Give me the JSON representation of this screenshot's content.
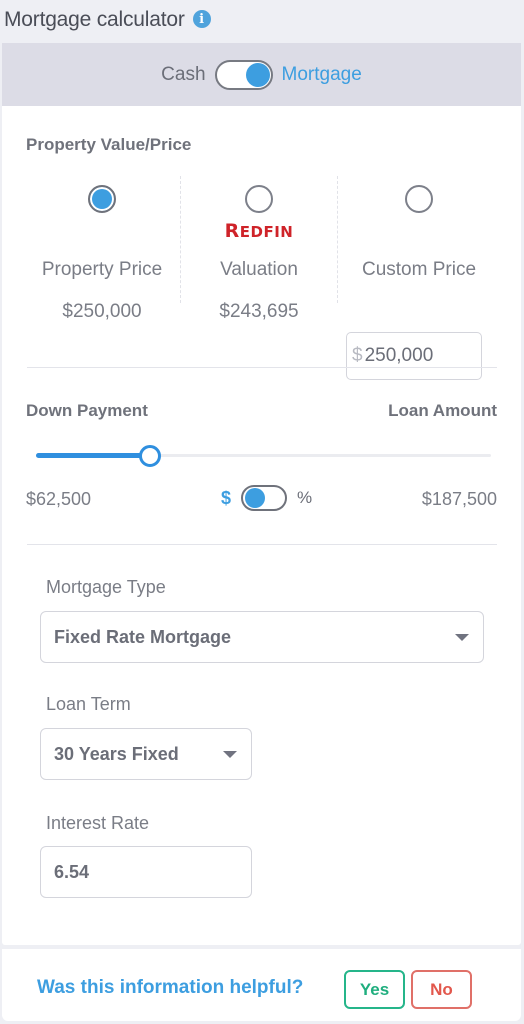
{
  "header": {
    "title": "Mortgage calculator",
    "info_icon": "info-icon"
  },
  "payment_mode": {
    "left_label": "Cash",
    "right_label": "Mortgage",
    "selected": "Mortgage"
  },
  "property_value": {
    "section_title": "Property Value/Price",
    "options": [
      {
        "label": "Property Price",
        "value": "$250,000",
        "selected": true
      },
      {
        "brand": "REDFIN",
        "label": "Valuation",
        "value": "$243,695",
        "selected": false
      },
      {
        "label": "Custom Price",
        "currency_symbol": "$",
        "input_value": "250,000",
        "selected": false
      }
    ]
  },
  "down_payment": {
    "title": "Down Payment",
    "loan_title": "Loan Amount",
    "slider_fraction": 0.25,
    "amount": "$62,500",
    "loan_amount": "$187,500",
    "unit_left": "$",
    "unit_right": "%",
    "unit_selected": "$"
  },
  "mortgage_type": {
    "label": "Mortgage Type",
    "selected": "Fixed Rate Mortgage"
  },
  "loan_term": {
    "label": "Loan Term",
    "selected": "30 Years Fixed"
  },
  "interest_rate": {
    "label": "Interest Rate",
    "value": "6.54"
  },
  "feedback": {
    "question": "Was this information helpful?",
    "yes_label": "Yes",
    "no_label": "No",
    "colors": {
      "yes": "#1fae7e",
      "no": "#e2574c",
      "accent": "#3d9ee0"
    }
  }
}
